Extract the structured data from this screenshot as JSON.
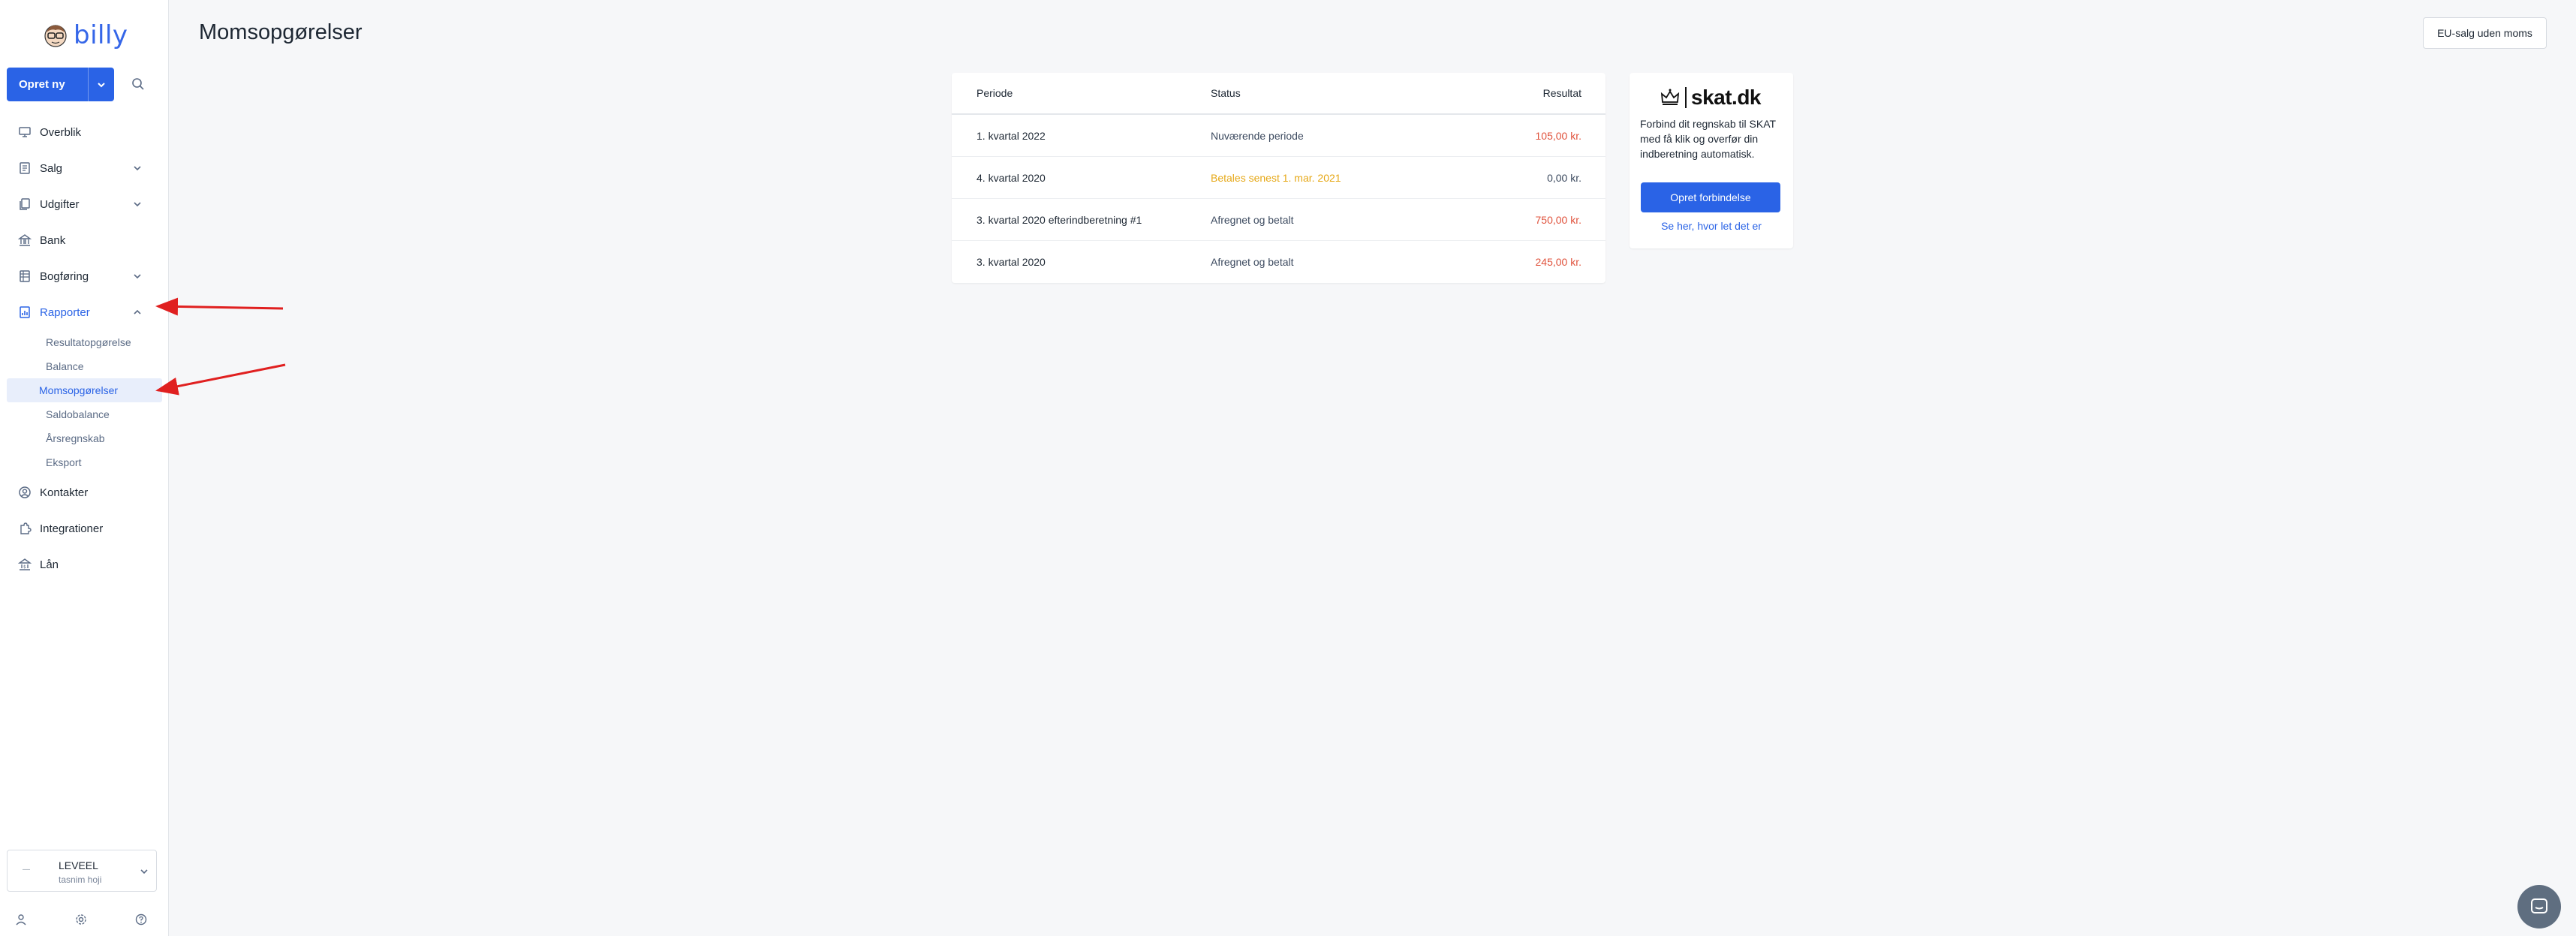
{
  "app": {
    "logo_text": "billy"
  },
  "sidebar": {
    "create_label": "Opret ny",
    "items": [
      {
        "label": "Overblik",
        "icon": "monitor-icon"
      },
      {
        "label": "Salg",
        "icon": "receipt-icon"
      },
      {
        "label": "Udgifter",
        "icon": "copy-icon"
      },
      {
        "label": "Bank",
        "icon": "bank-icon"
      },
      {
        "label": "Bogføring",
        "icon": "ledger-icon"
      },
      {
        "label": "Rapporter",
        "icon": "report-icon"
      },
      {
        "label": "Kontakter",
        "icon": "contacts-icon"
      },
      {
        "label": "Integrationer",
        "icon": "puzzle-icon"
      },
      {
        "label": "Lån",
        "icon": "loan-icon"
      }
    ],
    "reports_sub": [
      {
        "label": "Resultatopgørelse"
      },
      {
        "label": "Balance"
      },
      {
        "label": "Momsopgørelser"
      },
      {
        "label": "Saldobalance"
      },
      {
        "label": "Årsregnskab"
      },
      {
        "label": "Eksport"
      }
    ],
    "org": {
      "avatar": "—",
      "name": "LEVEEL",
      "user": "tasnim hoji"
    }
  },
  "main": {
    "title": "Momsopgørelser",
    "eu_button": "EU-salg uden moms",
    "table": {
      "headers": {
        "period": "Periode",
        "status": "Status",
        "result": "Resultat"
      },
      "rows": [
        {
          "period": "1. kvartal 2022",
          "status": "Nuværende periode",
          "result": "105,00 kr."
        },
        {
          "period": "4. kvartal 2020",
          "status": "Betales senest 1. mar. 2021",
          "result": "0,00 kr."
        },
        {
          "period": "3. kvartal 2020 efterindberetning #1",
          "status": "Afregnet og betalt",
          "result": "750,00 kr."
        },
        {
          "period": "3. kvartal 2020",
          "status": "Afregnet og betalt",
          "result": "245,00 kr."
        }
      ]
    },
    "skat": {
      "logo_text": "skat.dk",
      "description": "Forbind dit regnskab til SKAT med få klik og overfør din indberetning automatisk.",
      "button": "Opret forbindelse",
      "link": "Se her, hvor let det er"
    }
  },
  "colors": {
    "accent": "#2a63e6",
    "negative": "#e0533d",
    "warning": "#e6a817",
    "annotation": "#e02020"
  }
}
